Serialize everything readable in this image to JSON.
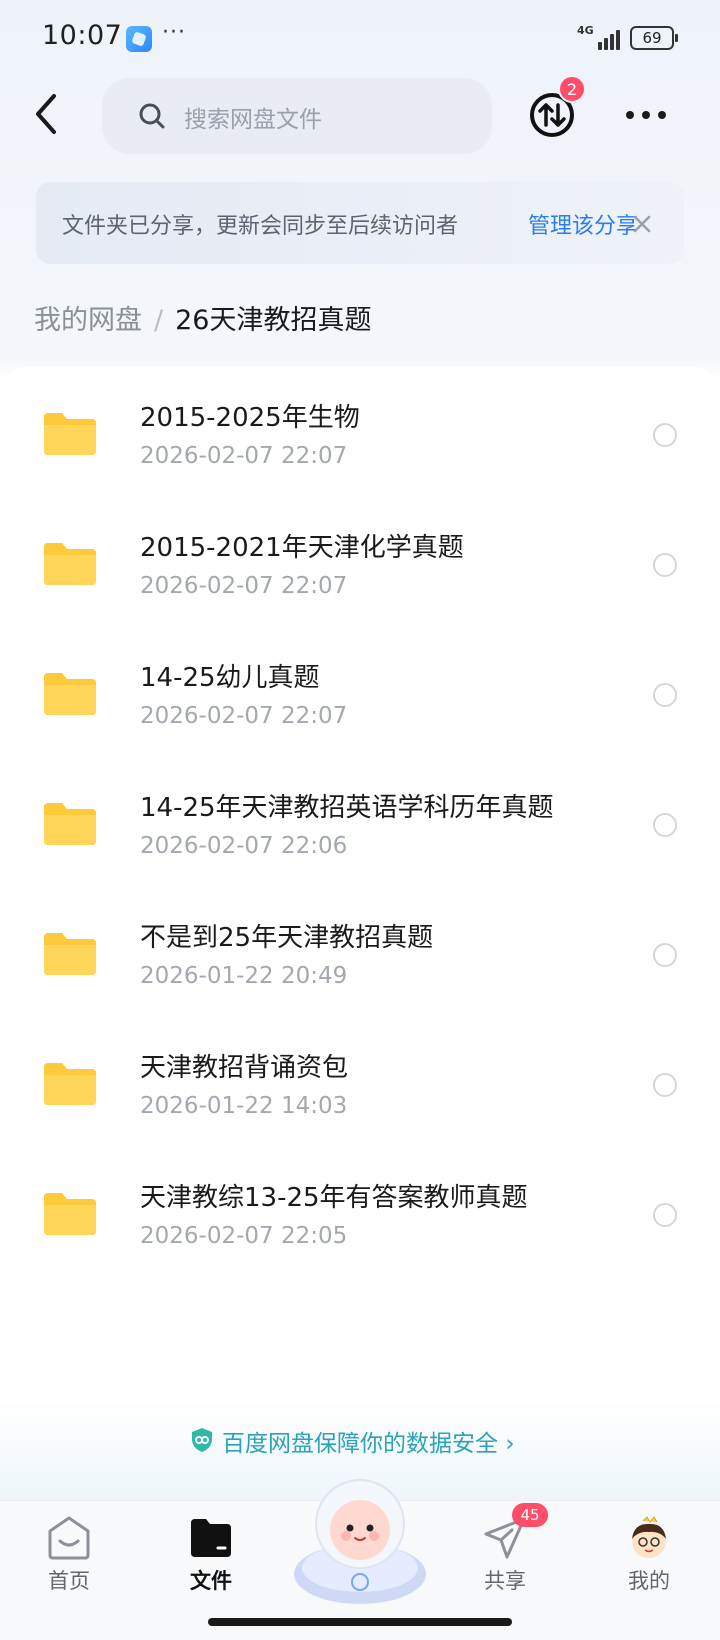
{
  "status_bar": {
    "time": "10:07",
    "more": "···",
    "network": "4G",
    "battery": "69"
  },
  "header": {
    "search_placeholder": "搜索网盘文件",
    "transfer_badge": "2"
  },
  "share_notice": {
    "text": "文件夹已分享，更新会同步至后续访问者",
    "link": "管理该分享"
  },
  "breadcrumb": {
    "root": "我的网盘",
    "separator": "/",
    "current": "26天津教招真题"
  },
  "files": [
    {
      "name": "2015-2025年生物",
      "date": "2026-02-07  22:07"
    },
    {
      "name": "2015-2021年天津化学真题",
      "date": "2026-02-07  22:07"
    },
    {
      "name": "14-25幼儿真题",
      "date": "2026-02-07  22:07"
    },
    {
      "name": "14-25年天津教招英语学科历年真题",
      "date": "2026-02-07  22:06"
    },
    {
      "name": "不是到25年天津教招真题",
      "date": "2026-01-22  20:49"
    },
    {
      "name": "天津教招背诵资包",
      "date": "2026-01-22  14:03"
    },
    {
      "name": "天津教综13-25年有答案教师真题",
      "date": "2026-02-07  22:05"
    }
  ],
  "safety_banner": {
    "text": "百度网盘保障你的数据安全",
    "arrow": "›"
  },
  "bottom_nav": {
    "home": "首页",
    "files": "文件",
    "share": "共享",
    "share_badge": "45",
    "me": "我的"
  },
  "colors": {
    "accent": "#2a7cf0",
    "badge": "#ff4d6a",
    "folder": "#ffc93c",
    "safety": "#2aa3b8"
  }
}
